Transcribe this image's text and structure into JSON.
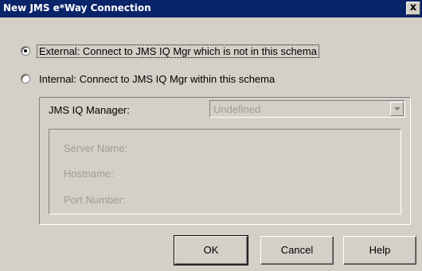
{
  "window": {
    "title": "New JMS e*Way Connection",
    "close_label": "x"
  },
  "connection_type": {
    "external_label": "External: Connect to JMS IQ Mgr which is not in this schema",
    "internal_label": "Internal: Connect to JMS IQ Mgr within this schema",
    "selected": "external"
  },
  "manager": {
    "label": "JMS IQ Manager:",
    "value": "Undefined"
  },
  "details": {
    "server_name_label": "Server Name:",
    "hostname_label": "Hostname:",
    "port_number_label": "Port Number:"
  },
  "buttons": {
    "ok": "OK",
    "cancel": "Cancel",
    "help": "Help"
  }
}
